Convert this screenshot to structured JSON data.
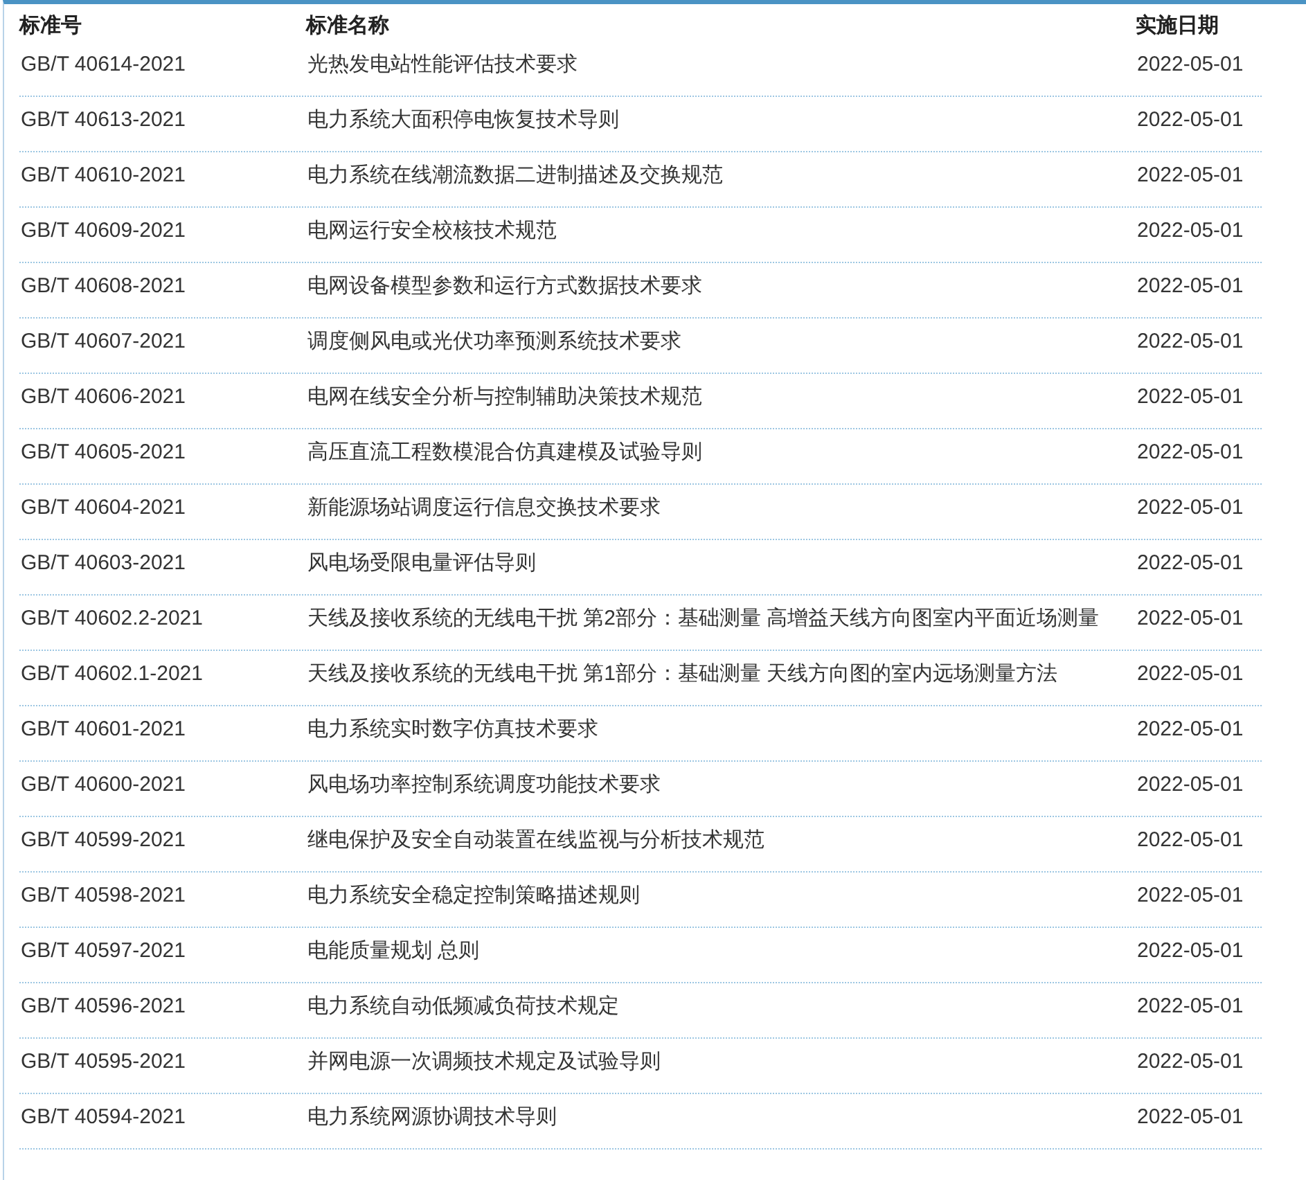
{
  "table": {
    "columns": [
      "标准号",
      "标准名称",
      "实施日期"
    ],
    "rows": [
      {
        "code": "GB/T 40614-2021",
        "name": "光热发电站性能评估技术要求",
        "date": "2022-05-01"
      },
      {
        "code": "GB/T 40613-2021",
        "name": "电力系统大面积停电恢复技术导则",
        "date": "2022-05-01"
      },
      {
        "code": "GB/T 40610-2021",
        "name": "电力系统在线潮流数据二进制描述及交换规范",
        "date": "2022-05-01"
      },
      {
        "code": "GB/T 40609-2021",
        "name": "电网运行安全校核技术规范",
        "date": "2022-05-01"
      },
      {
        "code": "GB/T 40608-2021",
        "name": "电网设备模型参数和运行方式数据技术要求",
        "date": "2022-05-01"
      },
      {
        "code": "GB/T 40607-2021",
        "name": "调度侧风电或光伏功率预测系统技术要求",
        "date": "2022-05-01"
      },
      {
        "code": "GB/T 40606-2021",
        "name": "电网在线安全分析与控制辅助决策技术规范",
        "date": "2022-05-01"
      },
      {
        "code": "GB/T 40605-2021",
        "name": "高压直流工程数模混合仿真建模及试验导则",
        "date": "2022-05-01"
      },
      {
        "code": "GB/T 40604-2021",
        "name": "新能源场站调度运行信息交换技术要求",
        "date": "2022-05-01"
      },
      {
        "code": "GB/T 40603-2021",
        "name": "风电场受限电量评估导则",
        "date": "2022-05-01"
      },
      {
        "code": "GB/T 40602.2-2021",
        "name": "天线及接收系统的无线电干扰 第2部分：基础测量 高增益天线方向图室内平面近场测量",
        "date": "2022-05-01"
      },
      {
        "code": "GB/T 40602.1-2021",
        "name": "天线及接收系统的无线电干扰 第1部分：基础测量 天线方向图的室内远场测量方法",
        "date": "2022-05-01"
      },
      {
        "code": "GB/T 40601-2021",
        "name": "电力系统实时数字仿真技术要求",
        "date": "2022-05-01"
      },
      {
        "code": "GB/T 40600-2021",
        "name": "风电场功率控制系统调度功能技术要求",
        "date": "2022-05-01"
      },
      {
        "code": "GB/T 40599-2021",
        "name": "继电保护及安全自动装置在线监视与分析技术规范",
        "date": "2022-05-01"
      },
      {
        "code": "GB/T 40598-2021",
        "name": "电力系统安全稳定控制策略描述规则",
        "date": "2022-05-01"
      },
      {
        "code": "GB/T 40597-2021",
        "name": "电能质量规划 总则",
        "date": "2022-05-01"
      },
      {
        "code": "GB/T 40596-2021",
        "name": "电力系统自动低频减负荷技术规定",
        "date": "2022-05-01"
      },
      {
        "code": "GB/T 40595-2021",
        "name": "并网电源一次调频技术规定及试验导则",
        "date": "2022-05-01"
      },
      {
        "code": "GB/T 40594-2021",
        "name": "电力系统网源协调技术导则",
        "date": "2022-05-01"
      }
    ]
  }
}
